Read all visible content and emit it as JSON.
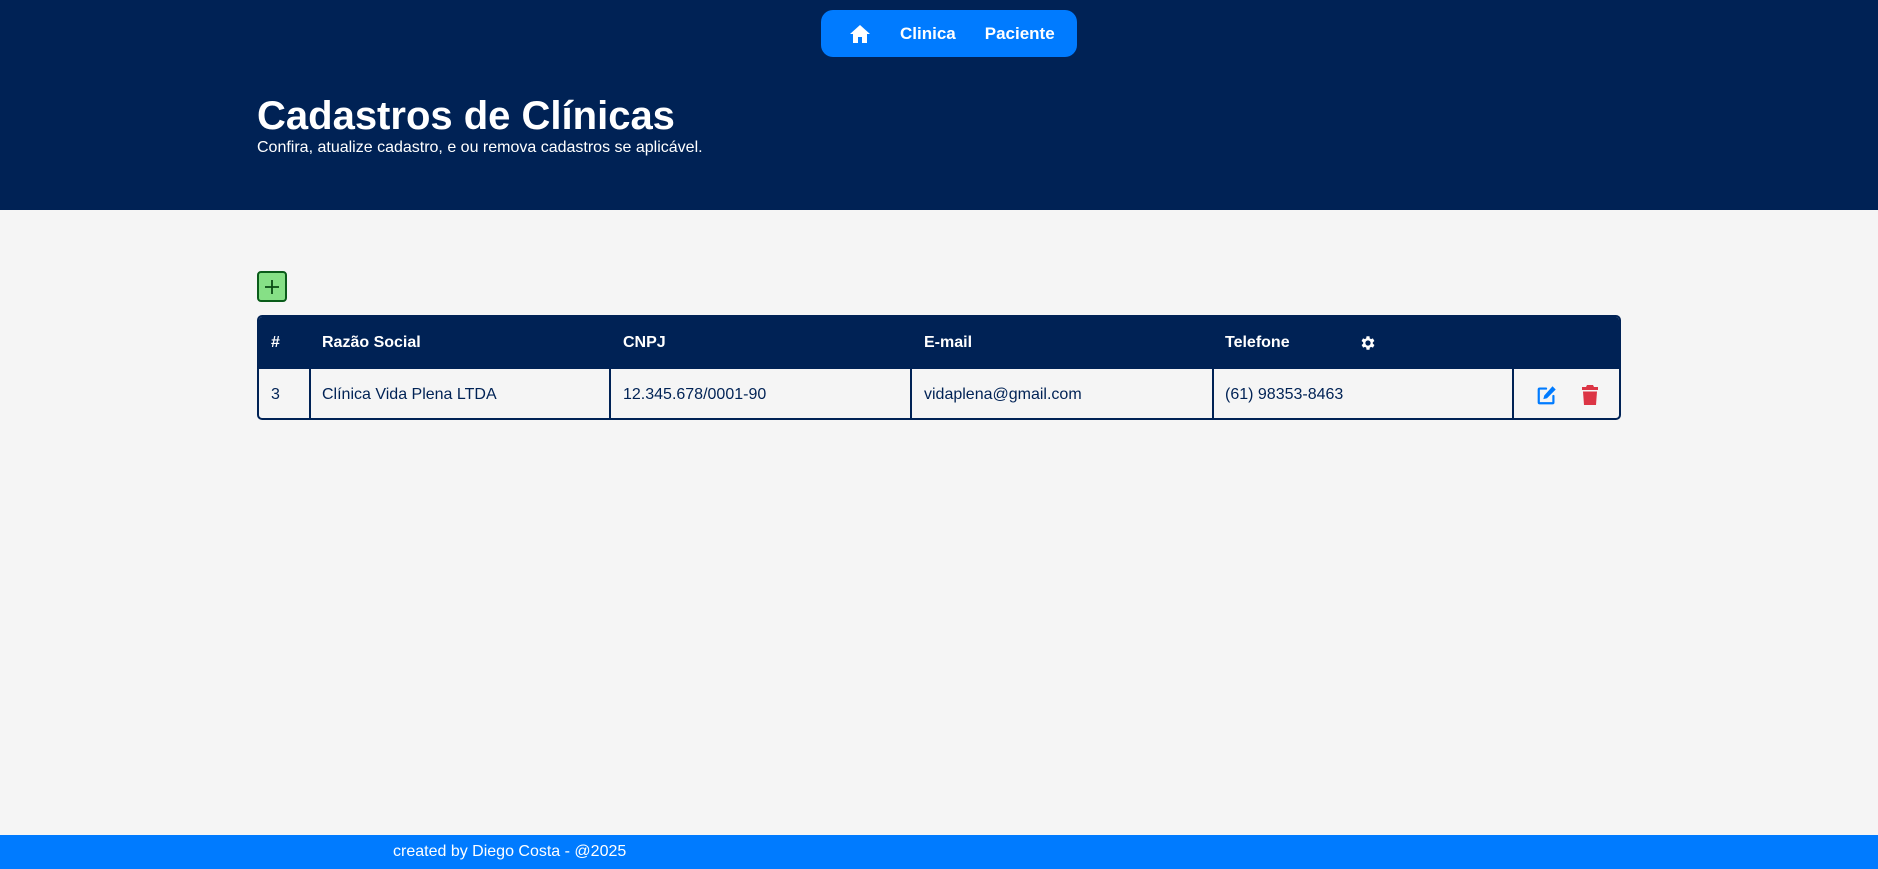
{
  "nav": {
    "home_icon": "home-icon",
    "links": [
      {
        "label": "Clinica"
      },
      {
        "label": "Paciente"
      }
    ],
    "color": "#007bff"
  },
  "header": {
    "title": "Cadastros de Clínicas",
    "subtitle": "Confira, atualize cadastro, e ou remova cadastros se aplicável.",
    "background": "#002255"
  },
  "toolbar": {
    "add_icon": "plus-icon",
    "add_color": "#86e086"
  },
  "table": {
    "columns": [
      "#",
      "Razão Social",
      "CNPJ",
      "E-mail",
      "Telefone"
    ],
    "actions_header_icon": "gear-icon",
    "rows": [
      {
        "id": "3",
        "razao_social": "Clínica Vida Plena LTDA",
        "cnpj": "12.345.678/0001-90",
        "email": "vidaplena@gmail.com",
        "telefone": "(61) 98353-8463",
        "actions": {
          "edit_icon": "edit-icon",
          "delete_icon": "trash-icon"
        }
      }
    ],
    "edit_color": "#007bff",
    "delete_color": "#dc3545"
  },
  "footer": {
    "text": "created by Diego Costa - @2025"
  }
}
